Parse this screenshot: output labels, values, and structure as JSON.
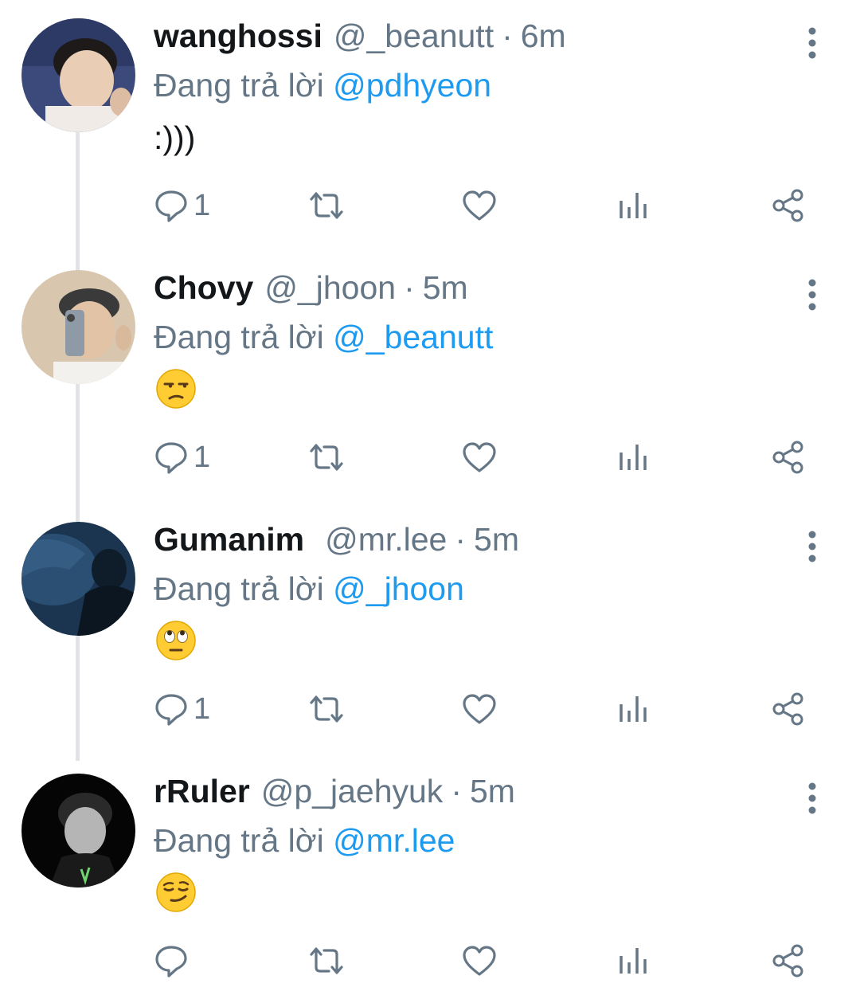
{
  "tweets": [
    {
      "name": "wanghossi",
      "handle": "@_beanutt",
      "separator": "·",
      "time": "6m",
      "reply_prefix": "Đang trả lời",
      "reply_to": "@pdhyeon",
      "text": ":)))",
      "emoji_icon": "",
      "reply_count": "1"
    },
    {
      "name": "Chovy",
      "handle": "@_jhoon",
      "separator": "·",
      "time": "5m",
      "reply_prefix": "Đang trả lời",
      "reply_to": "@_beanutt",
      "text": "",
      "emoji_icon": "unamused-face-emoji",
      "reply_count": "1"
    },
    {
      "name": "Gumanim",
      "handle": "@mr.lee",
      "separator": "·",
      "time": "5m",
      "reply_prefix": "Đang trả lời",
      "reply_to": "@_jhoon",
      "text": "",
      "emoji_icon": "rolling-eyes-emoji",
      "reply_count": "1"
    },
    {
      "name": "rRuler",
      "handle": "@p_jaehyuk",
      "separator": "·",
      "time": "5m",
      "reply_prefix": "Đang trả lời",
      "reply_to": "@mr.lee",
      "text": "",
      "emoji_icon": "smirking-face-emoji",
      "reply_count": ""
    }
  ],
  "colors": {
    "mention": "#1d9bf0",
    "secondary_text": "#657786",
    "thread_line": "#e1e3e6",
    "icon": "#657786"
  },
  "icons": [
    "reply-icon",
    "retweet-icon",
    "like-icon",
    "views-icon",
    "share-icon",
    "more-options-icon"
  ]
}
